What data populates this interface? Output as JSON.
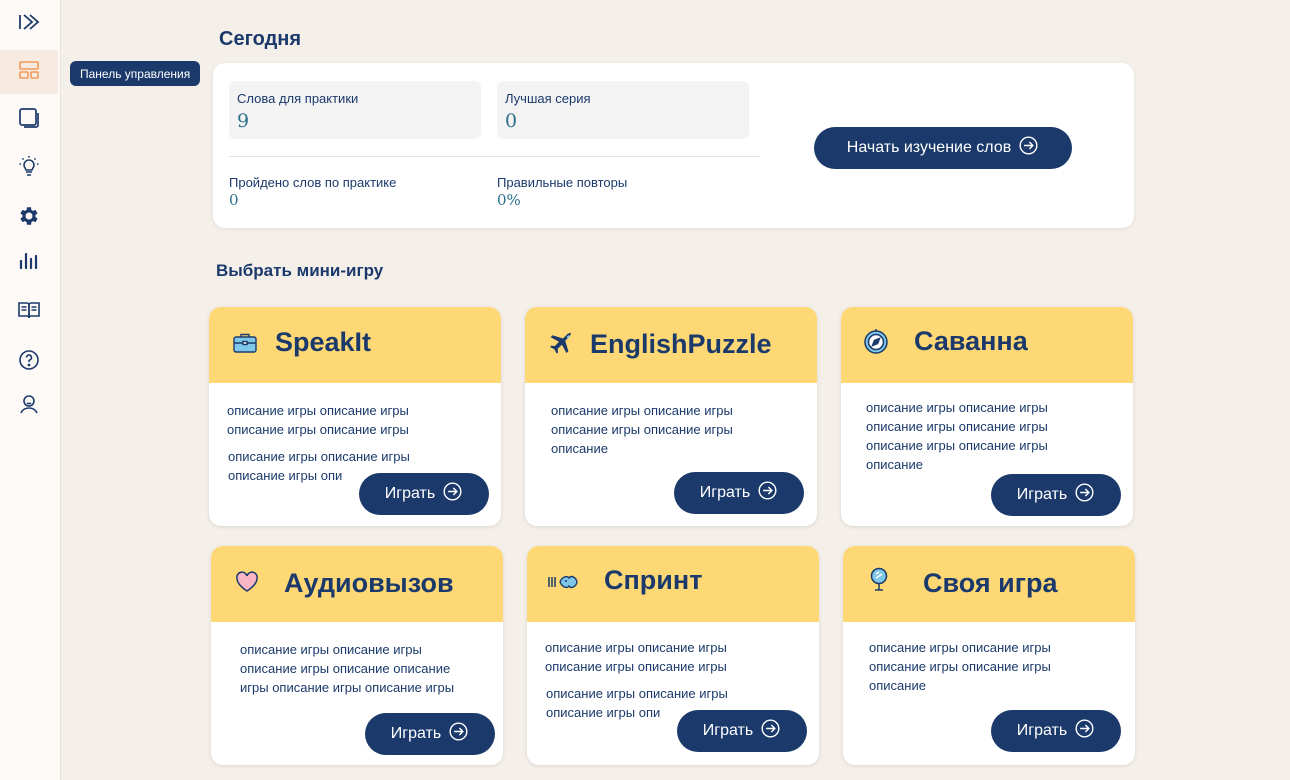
{
  "sidebar": {
    "tooltip": "Панель управления",
    "items": [
      {
        "icon": "collapse-arrow-icon"
      },
      {
        "icon": "dashboard-icon"
      },
      {
        "icon": "cards-icon"
      },
      {
        "icon": "lightbulb-icon"
      },
      {
        "icon": "gear-icon"
      },
      {
        "icon": "bar-chart-icon"
      },
      {
        "icon": "book-icon"
      },
      {
        "icon": "help-icon"
      },
      {
        "icon": "user-icon"
      }
    ]
  },
  "today": {
    "heading": "Сегодня",
    "words_to_practice_label": "Слова для практики",
    "words_to_practice_value": "9",
    "best_streak_label": "Лучшая серия",
    "best_streak_value": "0",
    "practiced_words_label": "Пройдено слов по практике",
    "practiced_words_value": "0",
    "correct_repeats_label": "Правильные повторы",
    "correct_repeats_value": "0%",
    "start_button": "Начать изучение слов"
  },
  "games": {
    "heading": "Выбрать мини-игру",
    "play_label": "Играть",
    "cards": [
      {
        "title": "SpeakIt",
        "icon": "briefcase-icon",
        "desc1": "описание игры описание игры описание игры описание игры",
        "desc2": "описание игры описание игры описание игры опи"
      },
      {
        "title": "EnglishPuzzle",
        "icon": "airplane-icon",
        "desc1": "описание игры описание игры описание игры описание игры описание",
        "desc2": ""
      },
      {
        "title": "Саванна",
        "icon": "compass-icon",
        "desc1": "описание игры описание игры описание игры описание игры описание игры описание игры описание",
        "desc2": ""
      },
      {
        "title": "Аудиовызов",
        "icon": "heart-icon",
        "desc1": "описание игры описание игры описание игры описание описание игры описание игры описание игры",
        "desc2": ""
      },
      {
        "title": "Спринт",
        "icon": "fish-icon",
        "desc1": "описание игры описание игры описание игры описание игры",
        "desc2": "описание игры описание игры описание игры опи"
      },
      {
        "title": "Своя игра",
        "icon": "mirror-icon",
        "desc1": "описание игры описание игры описание игры описание игры описание",
        "desc2": ""
      }
    ]
  },
  "colors": {
    "primary": "#1b3a6b",
    "card_header": "#fed874",
    "background": "#f5efea",
    "active_icon": "#f29a5a",
    "value_text": "#2b6f8a"
  }
}
